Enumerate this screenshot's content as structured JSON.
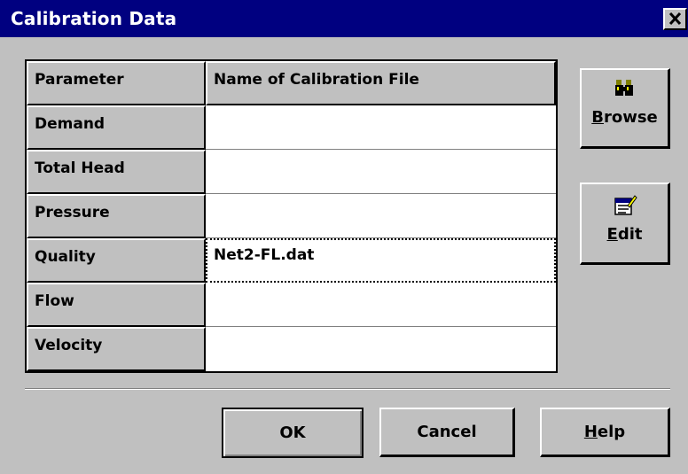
{
  "window": {
    "title": "Calibration Data",
    "close_glyph": "✕"
  },
  "grid": {
    "headers": [
      "Parameter",
      "Name of Calibration File"
    ],
    "rows": [
      {
        "parameter": "Demand",
        "file": ""
      },
      {
        "parameter": "Total Head",
        "file": ""
      },
      {
        "parameter": "Pressure",
        "file": ""
      },
      {
        "parameter": "Quality",
        "file": "Net2-FL.dat"
      },
      {
        "parameter": "Flow",
        "file": ""
      },
      {
        "parameter": "Velocity",
        "file": ""
      }
    ],
    "focused_row": "Quality"
  },
  "side_buttons": {
    "browse": {
      "label_mnemonic": "B",
      "label_rest": "rowse",
      "icon": "binoculars-icon"
    },
    "edit": {
      "label_mnemonic": "E",
      "label_rest": "dit",
      "icon": "notepad-edit-icon"
    }
  },
  "bottom_buttons": {
    "ok": {
      "label": "OK"
    },
    "cancel": {
      "label": "Cancel"
    },
    "help": {
      "label_mnemonic": "H",
      "label_rest": "elp"
    }
  },
  "colors": {
    "titlebar": "#000080",
    "face": "#c0c0c0",
    "cell_bg": "#ffffff"
  }
}
